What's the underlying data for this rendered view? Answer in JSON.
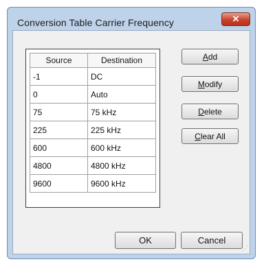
{
  "window": {
    "title": "Conversion Table Carrier Frequency"
  },
  "table": {
    "headers": [
      "Source",
      "Destination"
    ],
    "rows": [
      [
        "-1",
        "DC"
      ],
      [
        "0",
        "Auto"
      ],
      [
        "75",
        "75 kHz"
      ],
      [
        "225",
        "225 kHz"
      ],
      [
        "600",
        "600 kHz"
      ],
      [
        "4800",
        "4800 kHz"
      ],
      [
        "9600",
        "9600 kHz"
      ]
    ]
  },
  "buttons": {
    "add": {
      "mnemonic": "A",
      "rest": "dd"
    },
    "modify": {
      "mnemonic": "M",
      "rest": "odify"
    },
    "delete": {
      "mnemonic": "D",
      "rest": "elete"
    },
    "clear_all": {
      "mnemonic": "C",
      "rest": "lear All"
    },
    "ok": "OK",
    "cancel": "Cancel"
  },
  "colors": {
    "frame": "#bed3ea",
    "client": "#f0f0f0",
    "close_button": "#c8432b"
  }
}
